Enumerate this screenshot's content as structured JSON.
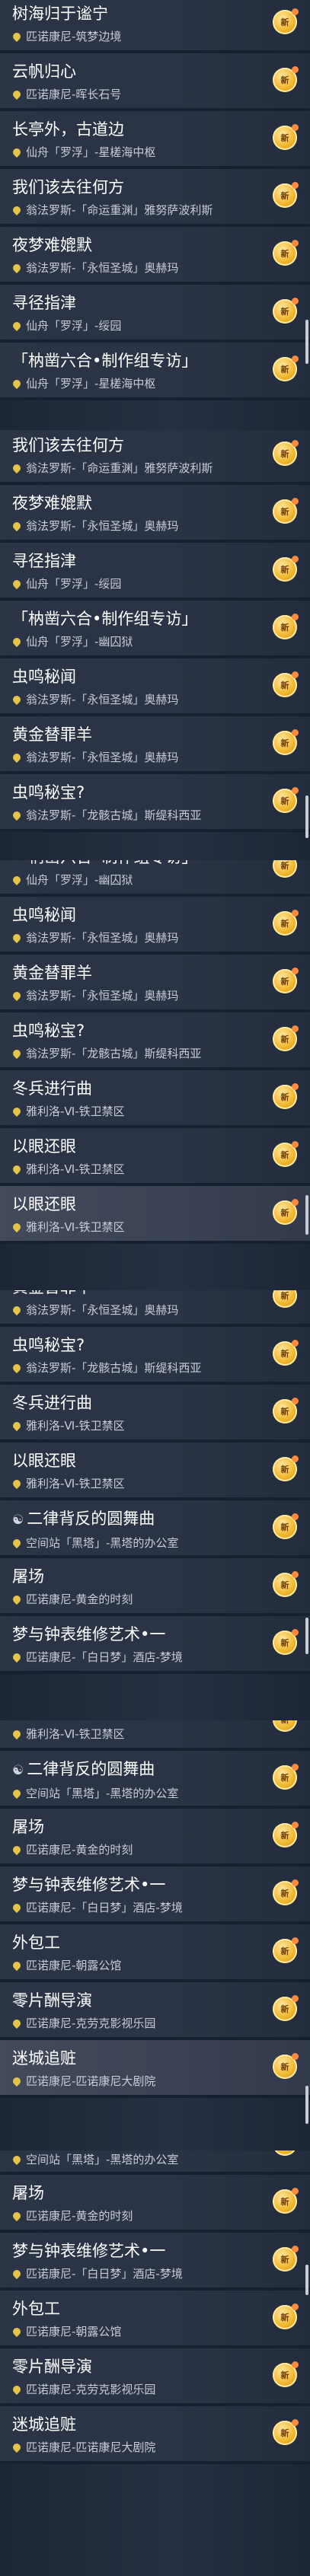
{
  "items": {
    "lin": {
      "title": "树海归于谧宁",
      "loc": "匹诺康尼-筑梦边境"
    },
    "yun": {
      "title": "云帆归心",
      "loc": "匹诺康尼-晖长石号"
    },
    "chang": {
      "title": "长亭外，古道边",
      "loc": "仙舟「罗浮」-星槎海中枢"
    },
    "women": {
      "title": "我们该去往何方",
      "loc": "翁法罗斯-「命运重渊」雅努萨波利斯"
    },
    "yemeng": {
      "title": "夜梦难媲默",
      "loc": "翁法罗斯-「永恒圣城」奥赫玛"
    },
    "xun": {
      "title": "寻径指津",
      "loc": "仙舟「罗浮」-绥园"
    },
    "zhizuo": {
      "title": "「枘凿六合•制作组专访」",
      "loc": "仙舟「罗浮」-星槎海中枢"
    },
    "zhizuo2": {
      "title": "「枘凿六合•制作组专访」",
      "loc": "仙舟「罗浮」-幽囚狱"
    },
    "chongming": {
      "title": "虫鸣秘闻",
      "loc": "翁法罗斯-「永恒圣城」奥赫玛"
    },
    "huangjin": {
      "title": "黄金替罪羊",
      "loc": "翁法罗斯-「永恒圣城」奥赫玛"
    },
    "mibao": {
      "title": "虫鸣秘宝?",
      "loc": "翁法罗斯-「龙骸古城」斯缇科西亚"
    },
    "dongbing": {
      "title": "冬兵进行曲",
      "loc": "雅利洛-Ⅵ-铁卫禁区"
    },
    "yiyan": {
      "title": "以眼还眼",
      "loc": "雅利洛-Ⅵ-铁卫禁区"
    },
    "erlv": {
      "title": "二律背反的圆舞曲",
      "loc": "空间站「黑塔」-黑塔的办公室"
    },
    "tuchang": {
      "title": "屠场",
      "loc": "匹诺康尼-黄金的时刻"
    },
    "mengyu": {
      "title": "梦与钟表维修艺术•一",
      "loc": "匹诺康尼-「白日梦」酒店-梦境"
    },
    "waibao": {
      "title": "外包工",
      "loc": "匹诺康尼-朝露公馆"
    },
    "lingpian": {
      "title": "零片酬导演",
      "loc": "匹诺康尼-克劳克影视乐园"
    },
    "micheng": {
      "title": "迷城追赃",
      "loc": "匹诺康尼-匹诺康尼大剧院"
    }
  },
  "badge_icon": "mission-badge-icon",
  "location_icon": "location-pin-icon",
  "yin_icon": "yin-yang-icon",
  "badge_text": "新"
}
